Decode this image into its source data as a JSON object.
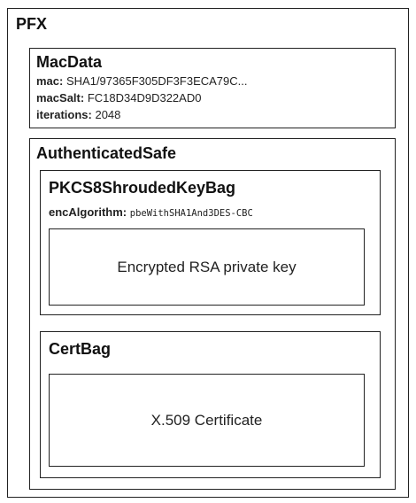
{
  "pfx": {
    "title": "PFX",
    "macdata": {
      "title": "MacData",
      "mac_label": "mac:",
      "mac_value": "SHA1/97365F305DF3F3ECA79C...",
      "macsalt_label": "macSalt:",
      "macsalt_value": "FC18D34D9D322AD0",
      "iterations_label": "iterations:",
      "iterations_value": "2048"
    },
    "authenticated_safe": {
      "title": "AuthenticatedSafe",
      "keybag": {
        "title": "PKCS8ShroudedKeyBag",
        "enc_label": "encAlgorithm:",
        "enc_value": "pbeWithSHA1And3DES-CBC",
        "content": "Encrypted RSA private key"
      },
      "certbag": {
        "title": "CertBag",
        "content": "X.509 Certificate"
      }
    }
  }
}
